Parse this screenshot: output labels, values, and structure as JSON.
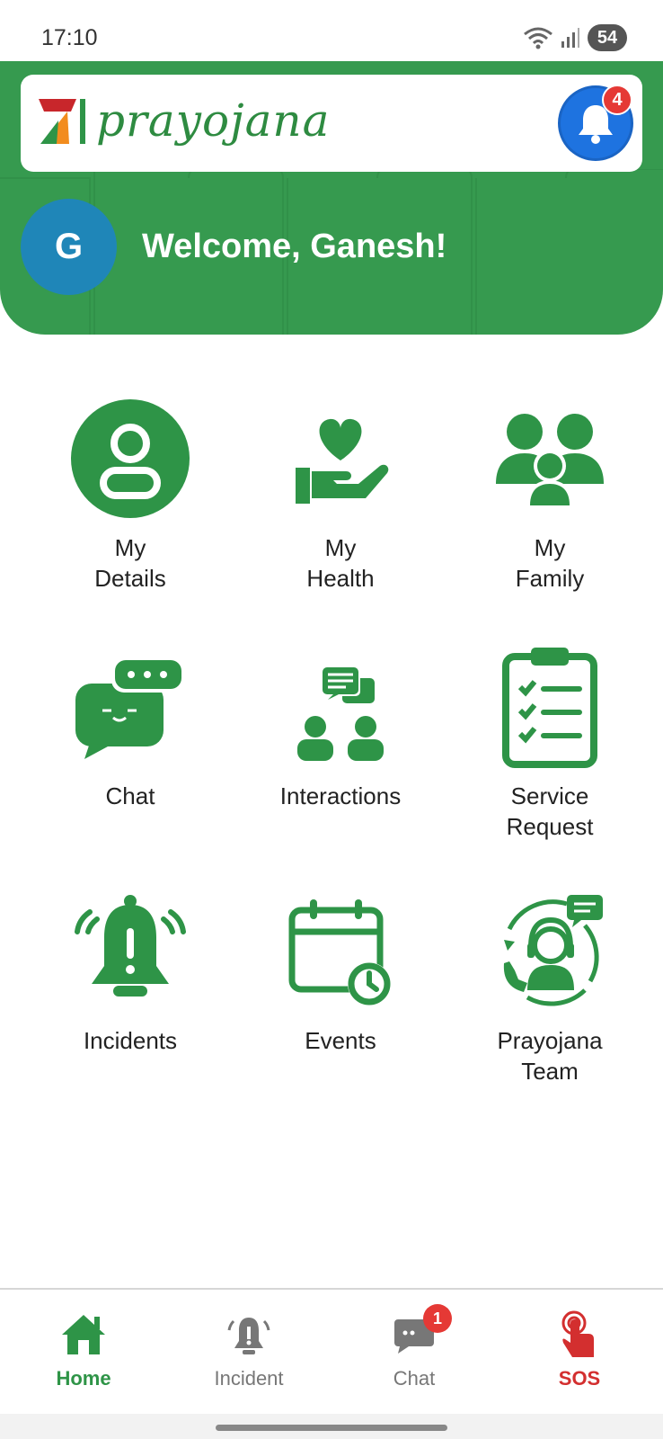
{
  "status_bar": {
    "time": "17:10",
    "battery": "54"
  },
  "header": {
    "brand_name": "prayojana",
    "notification_count": "4",
    "avatar_initial": "G",
    "welcome_text": "Welcome, Ganesh!"
  },
  "tiles": [
    {
      "line1": "My",
      "line2": "Details",
      "icon": "person-icon"
    },
    {
      "line1": "My",
      "line2": "Health",
      "icon": "heart-hand-icon"
    },
    {
      "line1": "My",
      "line2": "Family",
      "icon": "family-icon"
    },
    {
      "line1": "Chat",
      "line2": "",
      "icon": "chat-bubbles-icon"
    },
    {
      "line1": "Interactions",
      "line2": "",
      "icon": "interactions-icon"
    },
    {
      "line1": "Service",
      "line2": "Request",
      "icon": "clipboard-checklist-icon"
    },
    {
      "line1": "Incidents",
      "line2": "",
      "icon": "alarm-bell-icon"
    },
    {
      "line1": "Events",
      "line2": "",
      "icon": "calendar-clock-icon"
    },
    {
      "line1": "Prayojana",
      "line2": "Team",
      "icon": "support-agent-icon"
    }
  ],
  "bottom_nav": {
    "items": [
      {
        "label": "Home",
        "icon": "home-icon",
        "active": true
      },
      {
        "label": "Incident",
        "icon": "alarm-icon",
        "active": false
      },
      {
        "label": "Chat",
        "icon": "chat-icon",
        "active": false,
        "badge": "1"
      },
      {
        "label": "SOS",
        "icon": "sos-touch-icon",
        "active": false
      }
    ]
  },
  "colors": {
    "primary_green": "#369a4f",
    "icon_green": "#2e9447",
    "notification_blue": "#1e73e0",
    "badge_red": "#e53935",
    "avatar_blue": "#1f86b8",
    "sos_red": "#d32f2f",
    "nav_gray": "#777777"
  }
}
